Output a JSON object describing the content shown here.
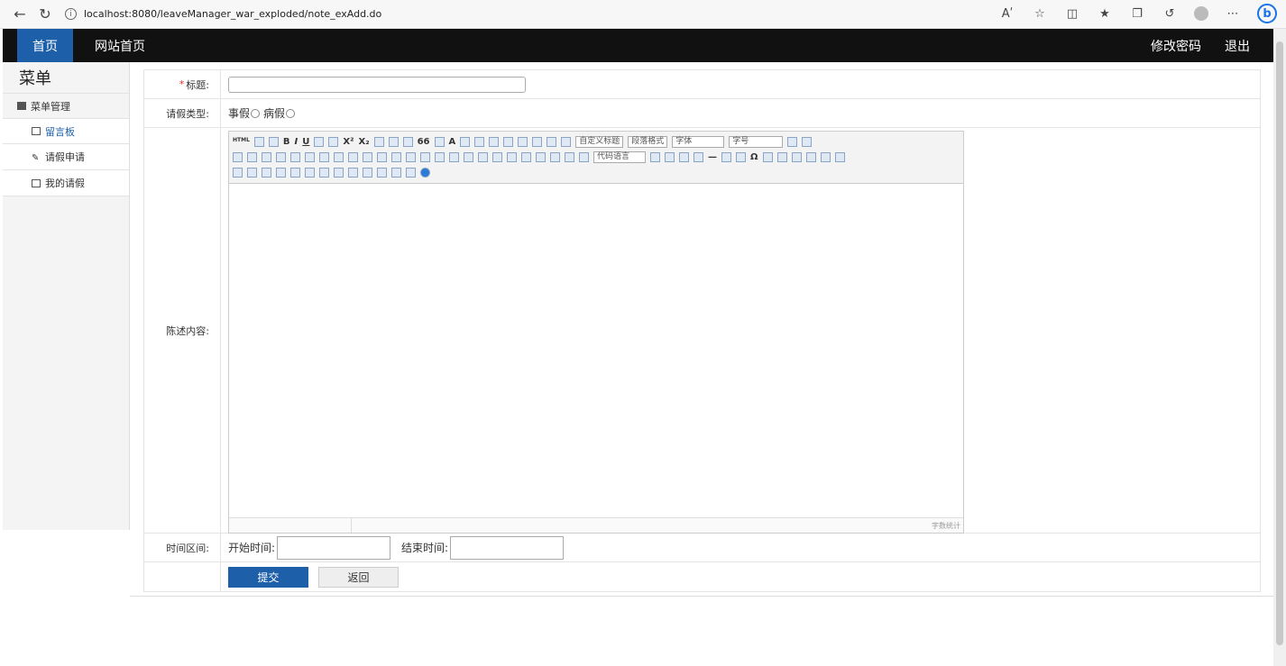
{
  "browser": {
    "url": "localhost:8080/leaveManager_war_exploded/note_exAdd.do",
    "read_aloud": "Aʹ"
  },
  "topnav": {
    "home": "首页",
    "site_home": "网站首页",
    "change_password": "修改密码",
    "logout": "退出"
  },
  "sidebar": {
    "title": "菜单",
    "group": "菜单管理",
    "items": [
      {
        "label": "留言板",
        "icon": "mail-icon"
      },
      {
        "label": "请假申请",
        "icon": "pen-icon"
      },
      {
        "label": "我的请假",
        "icon": "image-icon"
      }
    ]
  },
  "form": {
    "title_label": "标题:",
    "title_value": "",
    "type_label": "请假类型:",
    "type_options": [
      "事假",
      "病假"
    ],
    "content_label": "陈述内容:",
    "editor": {
      "html_btn": "HTML",
      "custom_title": "自定义标题",
      "paragraph": "段落格式",
      "font": "字体",
      "font_size": "字号",
      "code_lang": "代码语言",
      "word_count": "字数统计"
    },
    "time_label": "时间区间:",
    "start_label": "开始时间:",
    "end_label": "结束时间:",
    "submit": "提交",
    "back": "返回"
  }
}
